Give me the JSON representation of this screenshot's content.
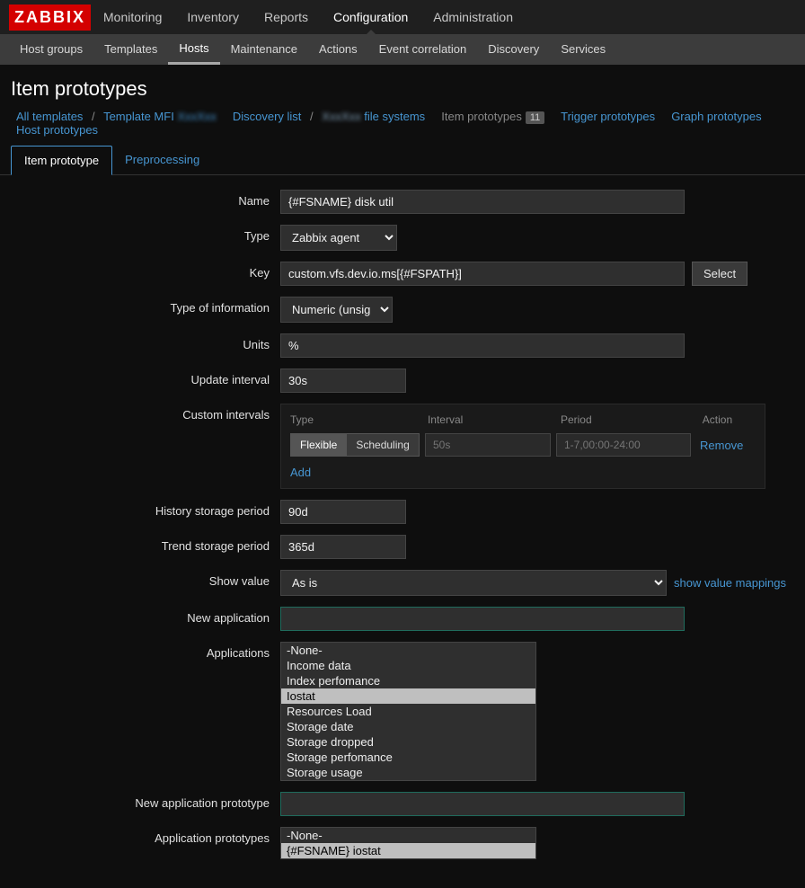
{
  "logo": "ZABBIX",
  "topnav": {
    "items": [
      "Monitoring",
      "Inventory",
      "Reports",
      "Configuration",
      "Administration"
    ],
    "active": "Configuration"
  },
  "subnav": {
    "items": [
      "Host groups",
      "Templates",
      "Hosts",
      "Maintenance",
      "Actions",
      "Event correlation",
      "Discovery",
      "Services"
    ],
    "active": "Hosts"
  },
  "page_title": "Item prototypes",
  "breadcrumb": {
    "all_templates": "All templates",
    "template_prefix": "Template MFI",
    "template_blur": "blurred",
    "discovery_list": "Discovery list",
    "fs_blur": "blurred",
    "fs_suffix": "file systems",
    "current": "Item prototypes",
    "current_count": "11",
    "trigger": "Trigger prototypes",
    "graph": "Graph prototypes",
    "host": "Host prototypes"
  },
  "tabs": {
    "item_prototype": "Item prototype",
    "preprocessing": "Preprocessing"
  },
  "form": {
    "labels": {
      "name": "Name",
      "type": "Type",
      "key": "Key",
      "type_of_info": "Type of information",
      "units": "Units",
      "update_interval": "Update interval",
      "custom_intervals": "Custom intervals",
      "history": "History storage period",
      "trend": "Trend storage period",
      "show_value": "Show value",
      "new_app": "New application",
      "applications": "Applications",
      "new_app_proto": "New application prototype",
      "app_protos": "Application prototypes"
    },
    "name": "{#FSNAME} disk util",
    "type_select": "Zabbix agent",
    "key": "custom.vfs.dev.io.ms[{#FSPATH}]",
    "select_btn": "Select",
    "type_info": "Numeric (unsigned)",
    "units": "%",
    "update_interval": "30s",
    "intervals": {
      "head_type": "Type",
      "head_interval": "Interval",
      "head_period": "Period",
      "head_action": "Action",
      "flexible": "Flexible",
      "scheduling": "Scheduling",
      "interval_placeholder": "50s",
      "period_placeholder": "1-7,00:00-24:00",
      "remove": "Remove",
      "add": "Add"
    },
    "history": "90d",
    "trend": "365d",
    "show_value": "As is",
    "show_value_link": "show value mappings",
    "new_application": "",
    "applications": [
      "-None-",
      "Income data",
      "Index perfomance",
      "Iostat",
      "Resources Load",
      "Storage date",
      "Storage dropped",
      "Storage perfomance",
      "Storage usage"
    ],
    "applications_selected": "Iostat",
    "new_app_proto": "",
    "app_protos": [
      "-None-",
      "{#FSNAME} iostat"
    ],
    "app_protos_selected": "{#FSNAME} iostat"
  }
}
